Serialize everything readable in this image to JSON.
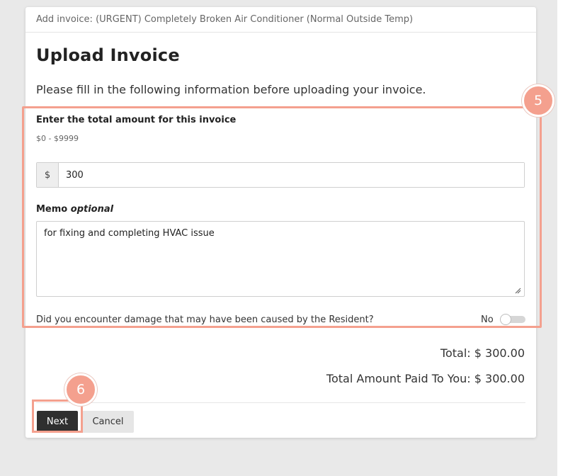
{
  "modal": {
    "header": "Add invoice: (URGENT) Completely Broken Air Conditioner (Normal Outside Temp)",
    "title": "Upload Invoice",
    "intro": "Please fill in the following information before uploading your invoice."
  },
  "amount": {
    "label": "Enter the total amount for this invoice",
    "hint": "$0 - $9999",
    "prefix": "$",
    "value": "300"
  },
  "memo": {
    "label": "Memo",
    "label_optional": "optional",
    "value": "for fixing and completing HVAC issue"
  },
  "damage": {
    "question": "Did you encounter damage that may have been caused by the Resident?",
    "toggle_label": "No",
    "toggle_on": false
  },
  "totals": {
    "total": "Total: $ 300.00",
    "paid": "Total Amount Paid To You: $ 300.00"
  },
  "buttons": {
    "next": "Next",
    "cancel": "Cancel"
  },
  "badges": {
    "step5": "5",
    "step6": "6"
  },
  "colors": {
    "highlight": "#f4a08e",
    "primary_button": "#2f2f2f"
  }
}
